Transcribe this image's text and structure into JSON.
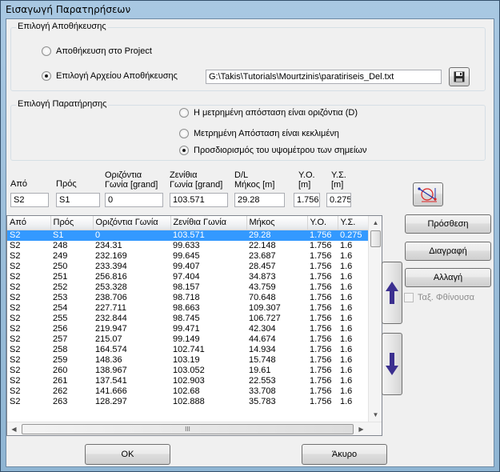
{
  "window": {
    "title": "Εισαγωγή Παρατηρήσεων"
  },
  "storage": {
    "group_label": "Επιλογή Αποθήκευσης",
    "option_project": "Αποθήκευση στο Project",
    "option_file": "Επιλογή Αρχείου Αποθήκευσης",
    "selected": "file",
    "file_path": "G:\\Takis\\Tutorials\\Mourtzinis\\paratiriseis_Del.txt",
    "save_icon": "floppy-disk-icon"
  },
  "observation": {
    "group_label": "Επιλογή Παρατήρησης",
    "option_horizontal": "Η μετρημένη απόσταση είναι οριζόντια (D)",
    "option_inclined": "Μετρημένη Απόσταση είναι  κεκλιμένη",
    "option_heights": "Προσδιορισμός του υψομέτρου  των σημείων",
    "selected": "heights"
  },
  "inputs": {
    "from_label": "Από",
    "to_label": "Πρός",
    "hangle_label_1": "Οριζόντια",
    "hangle_label_2": "Γωνία [grand]",
    "zenith_label_1": "Ζενίθια",
    "zenith_label_2": "Γωνία [grand]",
    "dist_label_1": "D/L",
    "dist_label_2": "Μήκος [m]",
    "yo_label_1": "Υ.Ο.",
    "yo_label_2": "[m]",
    "ys_label_1": "Υ.Σ.",
    "ys_label_2": "[m]",
    "from_value": "S2",
    "to_value": "S1",
    "hangle_value": "0",
    "zenith_value": "103.571",
    "dist_value": "29.28",
    "yo_value": "1.756",
    "ys_value": "0.275",
    "diagram_icon": "height-diagram-icon"
  },
  "table": {
    "headers": [
      "Από",
      "Πρός",
      "Οριζόντια Γωνία",
      "Ζενίθια Γωνία",
      "Μήκος",
      "Υ.Ο.",
      "Υ.Σ."
    ],
    "selected_row": 0,
    "rows": [
      [
        "S2",
        "S1",
        "0",
        "103.571",
        "29.28",
        "1.756",
        "0.275"
      ],
      [
        "S2",
        "248",
        "234.31",
        "99.633",
        "22.148",
        "1.756",
        "1.6"
      ],
      [
        "S2",
        "249",
        "232.169",
        "99.645",
        "23.687",
        "1.756",
        "1.6"
      ],
      [
        "S2",
        "250",
        "233.394",
        "99.407",
        "28.457",
        "1.756",
        "1.6"
      ],
      [
        "S2",
        "251",
        "256.816",
        "97.404",
        "34.873",
        "1.756",
        "1.6"
      ],
      [
        "S2",
        "252",
        "253.328",
        "98.157",
        "43.759",
        "1.756",
        "1.6"
      ],
      [
        "S2",
        "253",
        "238.706",
        "98.718",
        "70.648",
        "1.756",
        "1.6"
      ],
      [
        "S2",
        "254",
        "227.711",
        "98.663",
        "109.307",
        "1.756",
        "1.6"
      ],
      [
        "S2",
        "255",
        "232.844",
        "98.745",
        "106.727",
        "1.756",
        "1.6"
      ],
      [
        "S2",
        "256",
        "219.947",
        "99.471",
        "42.304",
        "1.756",
        "1.6"
      ],
      [
        "S2",
        "257",
        "215.07",
        "99.149",
        "44.674",
        "1.756",
        "1.6"
      ],
      [
        "S2",
        "258",
        "164.574",
        "102.741",
        "14.934",
        "1.756",
        "1.6"
      ],
      [
        "S2",
        "259",
        "148.36",
        "103.19",
        "15.748",
        "1.756",
        "1.6"
      ],
      [
        "S2",
        "260",
        "138.967",
        "103.052",
        "19.61",
        "1.756",
        "1.6"
      ],
      [
        "S2",
        "261",
        "137.541",
        "102.903",
        "22.553",
        "1.756",
        "1.6"
      ],
      [
        "S2",
        "262",
        "141.666",
        "102.68",
        "33.708",
        "1.756",
        "1.6"
      ],
      [
        "S2",
        "263",
        "128.297",
        "102.888",
        "35.783",
        "1.756",
        "1.6"
      ]
    ],
    "hscroll_grip": "III"
  },
  "actions": {
    "add": "Πρόσθεση",
    "delete": "Διαγραφή",
    "change": "Αλλαγή",
    "sort_desc": "Ταξ. Φθίνουσα",
    "move_up_icon": "arrow-up-icon",
    "move_down_icon": "arrow-down-icon"
  },
  "footer": {
    "ok": "OK",
    "cancel": "Άκυρο"
  },
  "colors": {
    "selection": "#3399ff",
    "arrow": "#3b2f8f",
    "title_bar": "#a9c8e2"
  }
}
